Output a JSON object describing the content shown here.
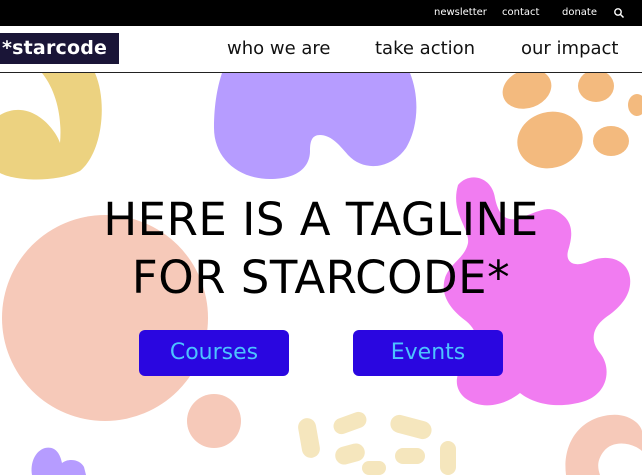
{
  "utility_nav": {
    "newsletter": "newsletter",
    "contact": "contact",
    "donate": "donate",
    "search_icon": "search-icon"
  },
  "header": {
    "logo": "*starcode",
    "nav": {
      "who_we_are": "who we are",
      "take_action": "take action",
      "our_impact": "our impact"
    }
  },
  "hero": {
    "tagline_line1": "HERE IS A TAGLINE",
    "tagline_line2": "FOR STARCODE*",
    "buttons": {
      "courses": "Courses",
      "events": "Events"
    }
  },
  "colors": {
    "button_bg": "#2a06e0",
    "button_text": "#4cc3ff",
    "yellow": "#ecd280",
    "purple": "#b69cff",
    "orange": "#f3ba7e",
    "peach": "#f6c9b9",
    "pink": "#f17cf1",
    "cream": "#f5e6bd"
  }
}
